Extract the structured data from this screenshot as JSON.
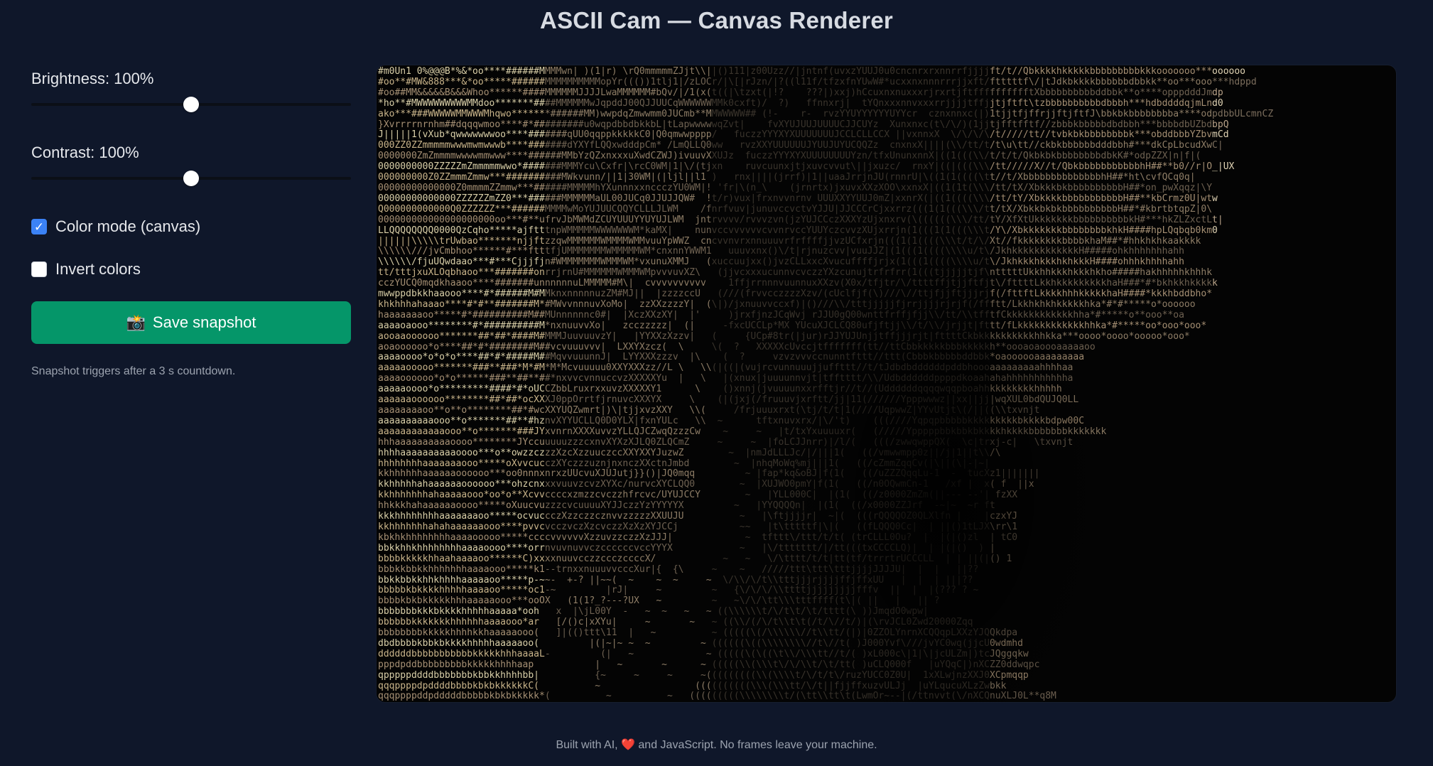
{
  "header": {
    "title": "ASCII Cam — Canvas Renderer"
  },
  "controls": {
    "brightness": {
      "label": "Brightness: 100%",
      "value": 100,
      "min": 0,
      "max": 200
    },
    "contrast": {
      "label": "Contrast: 100%",
      "value": 100,
      "min": 0,
      "max": 200
    },
    "color_mode": {
      "label": "Color mode (canvas)",
      "checked": true
    },
    "invert": {
      "label": "Invert colors",
      "checked": false
    },
    "save_button": {
      "icon": "camera-flash-icon",
      "icon_glyph": "📸",
      "label": "Save snapshot",
      "color": "#059669"
    },
    "hint": "Snapshot triggers after a 3 s countdown."
  },
  "canvas": {
    "ascii_rows": [
      "#m0Un1 0%@@@B*%&*oo****######MMMMwn| )(1|r) \\rQ0mmmmmZJjt\\\\||()111|z00Uzz//|jntnf(uvxzYUUJ0u0cncnrxrxnnrrfjjjjft/t//Qbkkkkhkkkkkbbbbbbbbbkkkooooooo***oooooo",
      "#oo**#MW&888***&*oo*****######MMMMMMMMMMopYr((())1tlj1|/zLOCr/|\\[|rJzn/|?((l11f/tfzxfnYUwW#*ucxxnxnnnrrrjjxft/ftttttf\\/|tJdkbkkkkbbbbbbdbbkk**oo***ooo***hdppd",
      "#oo##MM&&&&&B&&&Whoo******####MMMMMMJJJJLwaMMMMMM#bQv/|/1(x(t((|\\tzxt(|!?    ???|)xxj)hCcuxnxnuxxxrjrxrtjftfffffffffftXbbbbbbbbbbddbbk**o****opppdddJmdp",
      "*ho**#MWWWWWWWWWMMdoo*******####MMMMMMwJqpddJ00QJJUUCqWWWWWWMMk0cxft)/  ?)   ffnnxrj|  tYQnxxxnnvxxxrrjjjjtffjjtjftft\\tzbbbbbbbbbbdbbbh***hdbddddqjmLnd0",
      "ako***###WWWWWMMWWWMhqwo*******######MM)wwpdqZmwwmm0JUCmb**MMWWWWW## (!-    r-  rvzYYUYYYYYYUYYcr  cznxnnxc(|)1tjjtfjffrjjftjftfJ\\bbkbkbbbbbbbba****odpdbbULcmnCZ",
      "}Xvrrrrnrnhm##dqqqwmoo****#*#########u0wqpdbbdbkkbL|tLapwwwwwqZvt|    fvXYUJUUJUUUUCJJCUYz  Xunxnxc(t\\/\\/)(1jjtjfftfftf//zbbbkbbbbbdbdbbh***bbbbdbUZbdbpQ",
      "J|||||1(vXub*qwwwwwwwoo****#######qUU0qqppkkkkkC0|Q0qmwwpppp/   fuczzYYYXYXUUUUUUUJCCLCLLCCX ||vxnnxX  \\/\\/\\/\\/t/////tt//tvbkbkbbbbbbbbk***obddbbbYZbvmCd",
      "000ZZ0ZZmmmmmwwwmwmwwwb****#######dYXYfLQQxwdddpCm* /LmQLLQ0ww   rvzXXYUUUUUUJYUUJUYUCQQZz  cnxnxX||||(\\\\/tt/t/t\\u\\tt//ckbkbbbbbbdddbbh#***dkCpLbcudXwC|",
      "0000000ZmZmmmmwwwwmmwww****######MMbYzQZxnxxxuXwdCZWJ)ivuuvXXUJz  fuczzYYYXYXUUUUUUUUYzn/tfxUnunxnnX|((1(((\\\\/t/t/t/QkbkbkbbbbbbbbdbkK#*odpZZX|n|f|(",
      "0000000000ZZZZZmZmmmmmwwo*#######MMMYcu\\Cxfr|\\rcC0WM|1|\\/(tjxn    ruvcuunxjtjxuvcvvut\\||jxuzc/  rnxY|((|(((\\\\\\/tt/////X//t/QbkbbbbbbbbbbbhH##**b0//r|O_|UX",
      "000000000Z0ZZmmmZmmw***##########MWkvunn/||1|30WM|(|ljl||l1 )   rnx||||(jrrf)|1||uaaJrrjnJU(rnnrU|\\((1(1((((\\tt//t/XbbbbbbbbbbbbbbhH##*ht\\cvfQCq0q|",
      "00000000000000Z0mmmmZZmmw***######MMMMMhYXunnnxxnccczYU0WM|! 'fr|\\(n_\\    (jrnrtx)jxuvxXXzXOO\\xxnxX|((1(1t(\\\\\\/tt/tX/XbkkkbkbbbbbbbbbbH##*on_pwXqqz|\\Y",
      "00000000000000ZZZZZZmZZ0***######MMMMMMaUL00JUCq0JJUJJQW#  !t/r)vux|frxnvvnrnv UUUXXYYUUJ0mZ|xxnrX(|((1((((\\\\\\/tt/tY/XbkkkkbbbbbbbbbbbH##**kbCrmz0U|wtw",
      "Q000000000000Q0ZZZZZZ***######MMMMwMoYUJUUCQQYCLLLJLWM    /fnrfvuv|junuvccvctvYJJU|JJCCCrCjxxrrz(((1(1(((\\\\\\/tt/tX/XbkkbkbkbbbbbbbbbbH##*#kbrtbtqpZ|0\\",
      "000000000000000000000oo***#**ufrvJbMWMdZCUYUUUYYUYUJLWM  jntrvvvv/rvvvzvn(jzYUJCCczXXXYzUjxnxrv(\\((((((\\\\\\/tt/tY/XfXtUkkkkkkkbbbbbbbbbbkH#***hkZLZxctLt|",
      "LLQQQQQQQQ0000QzCqho*****ajftttnpWMMMMMWWWWWWWM*kaMX|    nunvccvvvvvvcvvnrvccYUUYczcvvzXUjxrrjn(1(((1(1(((\\\\\\t/Y\\/XbkkkkkkkbbbbbbbbkhkH####hpLQqbqb0km0",
      "||||||\\\\\\\\\\trUwbao*******njjftzzqwMMMMMMWMMMMWMMvuuYpWWZ  cncvvnvrxnnuuuvrfrffffjjvzUCfxrjn(((1(1((((\\\\\\t/t/\\/Xt//fkkkkkkkkbbbbkhaM##*#hhkhkhkaakkkk",
      "\\\\\\\\\\\\///jvCmbhoo******#***ftttfjUMMMMMMMWMMMMMWM*cnxnnYWWM1   uuuvxnx()\\/t|rjnuzcvv|vuuJJZ|(1(((1((((\\\\\\\\u/t\\/JkhkkkkkkkkkkkkH#####ohkhhhhhhhahh",
      "\\\\\\\\\\\\/fjuUQwdaao***#***Cjjjfjn#WMMMMMMMWMMMWM*vxunuXMMJ   (xuccuujxx()jvzCLLxxcXvucuffffjrjx(1(((1((((\\\\\\\\u/t\\/JkhkkkhkkkhkhkkkH####ohhhkhhhhahh",
      "tt/tttjxuXLOqbhaoo***#######onrrjrnU#MMMMMMWMMMWMpvvvuvXZ\\   (jjvcxxxucunnvcvczzYXzcunujtrfrfrr(1(((tjjjjjtjf\\ntttttUkkhhkkkhkkkhkho#####hakhhhhhkhhhk",
      "cczYUCQ0mqdkhaaoo****#######unnnnnnuLMMMMM#M\\|  cvvvvvvvvvv    1ffjrrnnnvuunnuxXXzv(X0x/tfjtr/\\/ttttffjtjjftfjt\\/fttttLkkhkkkkkkkkkhaH###*#*bkhkkhkkkkk",
      "mwwppdbkkhaaooo****#*######M#MMknxnnnnnuzZM#MJ||  |zzzzccU   (///(frvvcczzzzXzv/(cUclfjf(\\)///\\//ttjfjjftjjjrjf(/fttftLkkkkhhhkkkkkhaH####*kkkhbddbho*",
      "khkhhhahaaao****#*#**#######M*#MWvvnnnuvXoMo|  zzXXzzzzY|  (\\|)/jxnuuvvccxf)|()///\\\\/tttjjjjjfjrrjjjjrjrjf(/ffftt/Lkkhkhkhkkkkkhka*#*#*****o*oooooo",
      "haaaaaaaoo*****#*##########M##MUnnnnnnc0#|  |XczXXzXY|  |'     )jrxfjnzJCqWvj rJJU0gQ00wnttfrffjfjj\\\\/tt/\\\\tfftfCkkkkkkkkkkkkhha*#*****o**ooo**oa",
      "aaaaoaooo********#*##########M*nxnuuvvXo|   zcczzzzz|  (|     -fxcUCCLp*MX YUcuXJCLCQ80ufjftjj\\\\/t/\\\\/jrjjt|fttt/fLkkkkkkkkkkkkhhka*#*****oo*ooo*ooo*",
      "aooaaoooooo*******##*##*####M#MMMJuuvuuvzY|   |YYXXzXzzv|   (     {UCp#8tr(|jur)rJJYUJUnjjtffjjjrjt|fttttCkbkkkkkkkkkkhhkka***oooo*oooo*ooooo*ooo*",
      "aoaoooooo*o****##*#*########M##vcvuuuvvv|  LXXYXzcz(  \\     \\(  ?   XXXXXcUvccjtfffffff(tt//ttCbbkkkkkbbbkkkkkh**oooaoaoooaaaaaoo",
      "aaaaoooo*o*o*o****##*#*#####M##MqvvuuunnJ|  LYYXXXzzzv  |\\    (  ?     vzvzvvvccnunntfttt//ttt(Cbbbkbbbbbddbbk*oaoooooaaaaaaaaa",
      "aaaaaooooo*******###**###*M*#M*M*Mcvuuuuu0XXYXXXzz//L \\   \\\\(|((|(vujrcvunnuuujjuffttt//t/tJdbdbddddddpddbhoooaaaaaaaaahhhhaa",
      "aaaaoooooo*o*o******###**##**##*nxvvcvnnuccvzXXXXXYu  |   \\   |(xnux|juuuunnvjt|tfftttt/\\\\/Udbddddddppppdkoaahahahhhhhhhhhhha",
      "aaaaaoooo*o*********####*#*oUCCZbbLruxrxxuvzXXXXXY1      \\    ()xnnj(jvuuuunxxrfftjr//t//(Uddddddqqqqwqqpboahhkkkkkkkkhhhhh",
      "aaaaaaoooooo********##*##*ocXXXJ0ppOrrtfjrnuvcXXXYX     \\    (|(jxj(/fruuuvjxrftt/jj|11(//////Ypppwwwz||xx||jj|wqXUL0bdQUJQ0LL",
      "aaaaaaaaoo**o**o********##*#wcXXYUQZwmrt|)\\|tjjxvzXXY   \\\\(     /frjuuuxrxt(\\tj/t/t|1(////UqpwwZ|YYvUtjt\\(/||((\\\\txvnjt",
      "aaaaaaaaaaooo**o*******##**#hznvXYYUCLLQ0D0YLX|fxnYULc   \\\\  ~      tftxnuvxrx/|\\/'t)    (((////Yqpqpbbbbbkkkkkkkkkbkkkkbdpw00C",
      "aaaaaaaaaaaaooo**o*******###JYxvnrnXXXXuvvzYLLQJCZwqQzzzCw    ~     ~   |t/txYxuuuuxr(   (/////Ypppppbbkbbkbkkkkhkkkkbbbbbbbkkkkkkk",
      "hhhaaaaaaaaaaoooo********JYccuuuuuzzzcxnvXYXzXJLQ0ZLQCmZ     ~     ~  |foLCJJnrr)|/l/(   (((/zwwqwppQX(  \\c|trxj-c|   \\txvnjt",
      "hhhhaaaaaaaaaaoooo***o**owzzczzzXzcXzzuuczccXXYXXYJuzwZ        ~  |nmJdLLLJc/|/|||1(   ((/vmwwmpp0z||/j|1||t\\\\/\\",
      "hhhhhhhhaaaaaaaooo*****oXvvcucczXYczzzuznjnxnczXXctnJmbd        ~  |nhqMoWq%mj|||1(   ((/cZmmZqqCv(|\\||(\\|-|~|",
      "kkhhhhhhaaaaaaoooooo***oo0nnnxnrxzUUcvuXJUJutj}}()|JQ0mqq         ~ |fap*kq&oBJ|f(1(   ((/uZZZQqqLu-1  -  tucXz1|||||||",
      "kkhhhhhahaaaaaaoooooo***ohzcnxxxvuuvzcvzXYXc/nurvcXYCLQQ0        ~  |XUJWO0pmY|f(1(   ((/n0OQwmCn-1   /xf |  x( f  ||x",
      "kkhhhhhhhahaaaaaooo*oo*o**Xcvvccccxzmzzcvczzhfrcvc/UYUJCCY        ~   |YLL000C|  |(1(  ((/z0000ZmZm(||--- --'| fzXX",
      "hhkkkhahaaaaaaoooo*****oXuucvuzzzcvcuuuuXYJJczzYzYYYYYX         ~   |YYQQQQn|  |(1(  ((/x0000ZZJrf  -~|~  ~r ft",
      "kkkhhhhhhhhaaaaaaaoo*****ocvuccczXzzczzcznvvzzzzzXXUUJU          ~   |\\ftjjjjr|  ~|(  (((rQQQQOZ0QLXlfn |    |czxYJ",
      "kkhhhhhhhahahaaaaaaooo****pvvcvcczvczXzcvczzXzXzXYJCCj           ~~   |t\\tttttf|\\|(   ((fLQQQ0Cc|  | ||()1tLJX\\rr\\1",
      "kbkhkhhhhhhhhaaaaooooo*****ccccvvvvvvXzzuvzzczzXzJJJ|             ~  tfttt\\/ttt/t/t( (trCLLL0Ou?  |  |(|()zl  | tC0",
      "bbkkhhkhhhhhhhhaaaaoooo****orrnvuvnuvvczccccccvccYYYX            ~   |\\/ttttttt/|/tt(((txCCCCLQ)|  | |(|()  ) |",
      "bbbbkkkkkhhaahaaaaoo******C)xxxxnuuvcczzccczccccX/            ~   ~   \\/\\tttt/t/t|tt(tf/trrrtrUCCCLL  | | ||(|() 1",
      "bbbkkbbkkhhhhhhhaaaaooo*****k1--trnxxnuuuvvcccXur|{  {\\     ~    ~   /////ttt\\ttt\\tttjjjjJJJJU|  |  |   ||??       ",
      "bbkkbbkkhhkhhhhaaaaaoo*****p-~~-  +-? ||~~(  ~    ~  ~     ~  \\/\\\\/\\/t\\\\tttjjjrjjjjffjffxUU   |  |  | |||??  ",
      "bbbbbkbkkkkhhhhhaaaaoo*****oc1-~         |rJ|     ~         ~   {\\/\\/\\/\\\\ttttjjjjjjjjjfffv  ||  |  |(??? ? ~",
      "bbbbkbkbkkkkkhhhaaaaaooo***ooOX   (1(1?_?---?UX   ~         ~   ~\\/\\/\\tt\\\\\\tttffff(t\\|( ||   |   || ?",
      "bbbbbbbkkkbkkkkhhhhhaaaaa*ooh   x  |\\jL00Y  -   ~  ~   ~   ~ ((\\\\\\\\\\\\t/\\/t\\t/\\t/tttt(\\ ))JmqdO0wpw|",
      "bbbbbbkkkkkkkhhhhhhaaaaooo*ar   [/()c|xXYu|     ~       ~   ~ ((\\\\/(/\\/t\\\\t\\t(/t/\\//t/)|(\\rvJCL0Zwd20000Zqq",
      "bbbbbbbbkkkkkhhhhkkhaaaaaooo(   ]|(()ttt\\11  |   ~          ~ (((((\\(/\\\\\\\\\\\\//t\\\\tt/(|)|0ZZOLYnrnXCQQqpLXXzYJQQkdpa",
      "dbdbbbbkbbkbkkkkhhhhhaaaaaoo(         |(|~|~ ~  ~         ~ ((((((\\((\\\\\\\\\\\\\\\\//t\\//t( )J000Yvf\\///jvYC0wq(jjcU0wdmhd",
      "ddddddbbbbbbbbbbbkkkkkhhhaaaaL-         (|   ~             ~ (((((\\(\\((\\t\\\\/\\\\\\tt//t/( )xL000c\\|1|\\|jcULZm|)tcJQggqkw",
      "pppdpddbbbbbbbbbkkkkkhhhhaap           |   ~       ~      ~ (((((\\\\(\\\\\\t\\/\\/\\\\t/\\t/tt( )uCLQ000f   |uYQqC|)nXCZZ0ddwqpc",
      "qpppppddddbbbbbbbkbbkkhhhhbb|          {~     ~     ~     ~(((((((((\\\\(\\\\\\\\t/\\/t/t\\/ruzYUCC0Z0U|  1xXLwjnzXXJ0XCpmqqp",
      "qqqppppdpddddbbbbkbkbkkkkkkC(          ~                 ((((((((((\\\\\\(\\\\\\tt/\\/t||fjjffxuzvULJj  |uYLqucuXLzZwbkk",
      "qqqppppddpdddddbbbbbkbkbkkkkk*(          ~          ~   (((((((((\\\\\\\\\\\\\\\\t/(\\tt\\\\tt\\t(LwmOr~--|(/ttnvvt(\\/nXCQnuXLJ0L**q8M"
    ]
  },
  "footer": {
    "text": "Built with AI, ❤️ and JavaScript. No frames leave your machine."
  }
}
